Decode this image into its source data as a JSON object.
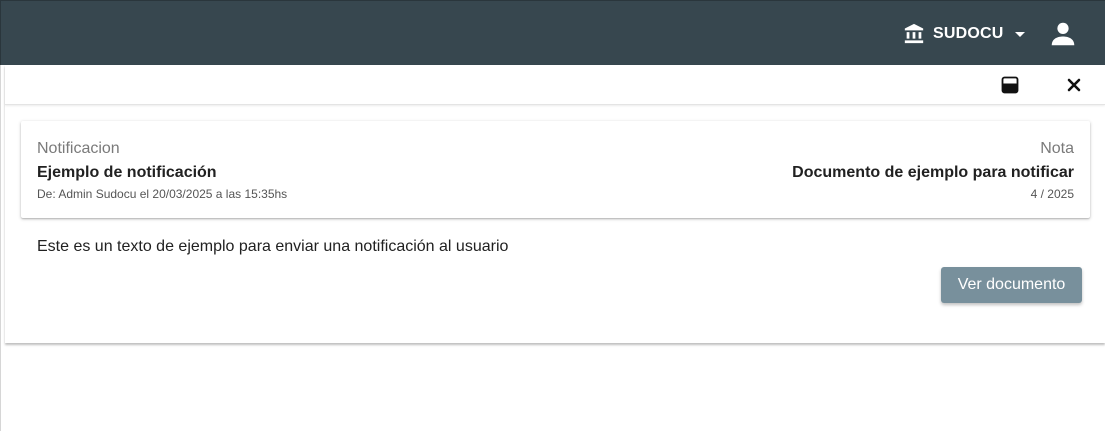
{
  "header": {
    "org_name": "SUDOCU",
    "org_icon": "bank-icon",
    "user_icon": "account-icon",
    "background": "#37474f"
  },
  "toolbar": {
    "archive_icon": "archive-icon",
    "close_icon": "close-icon"
  },
  "notification": {
    "left_label": "Notificacion",
    "title": "Ejemplo de notificación",
    "meta": "De: Admin Sudocu el 20/03/2025 a las 15:35hs",
    "right_label": "Nota",
    "document_title": "Documento de ejemplo para notificar",
    "document_number": "4 / 2025",
    "message": "Este es un texto de ejemplo para enviar una notificación al usuario",
    "view_button": "Ver documento",
    "button_color": "#78909c"
  }
}
